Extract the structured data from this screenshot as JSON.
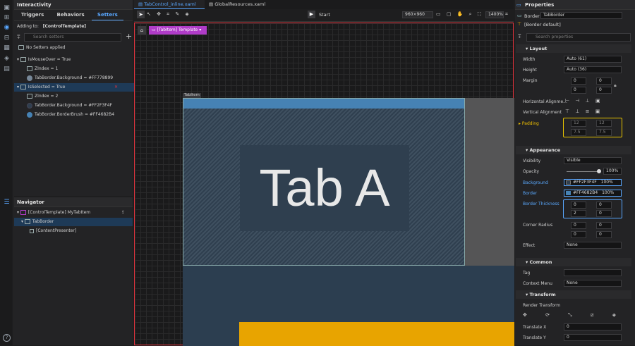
{
  "left_toolbar": {
    "icons": [
      "project-icon",
      "assets-icon",
      "interactivity-icon",
      "data-icon",
      "resources-icon",
      "triggers-icon",
      "states-icon",
      "navigator-icon"
    ],
    "help": "?"
  },
  "interactivity": {
    "title": "Interactivity",
    "tabs": [
      "Triggers",
      "Behaviors",
      "Setters"
    ],
    "adding_for_label": "Adding to:",
    "adding_for_value": "[ControlTemplate]",
    "search_placeholder": "Search setters",
    "rows": [
      "No Setters applied",
      "IsMouseOver = True",
      "ZIndex = 1",
      "TabBorder.Background = #FF778899",
      "IsSelected = True",
      "ZIndex = 2",
      "TabBorder.Background = #FF2F3F4F",
      "TabBorder.BorderBrush = #FF4682B4"
    ]
  },
  "navigator": {
    "title": "Navigator",
    "rows": [
      "[ControlTemplate] MyTabItem",
      "TabBorder",
      "[ContentPresenter]"
    ]
  },
  "editor": {
    "tabs": [
      "TabControl_inline.xaml",
      "GlobalResources.xaml"
    ],
    "start_label": "Start",
    "resolution": "960×960",
    "zoom": "1400%",
    "breadcrumb": "[TabItem] Template",
    "adorner_label": "TabItem",
    "content_text": "Tab A"
  },
  "properties": {
    "title": "Properties",
    "element_type": "Border",
    "element_name": "TabBorder",
    "style_label": "[Border default]",
    "search_placeholder": "Search properties",
    "layout": {
      "title": "Layout",
      "width_label": "Width",
      "width": "Auto (61)",
      "height_label": "Height",
      "height": "Auto (36)",
      "margin_label": "Margin",
      "margin": [
        "0",
        "0",
        "0",
        "0"
      ],
      "halign_label": "Horizontal Alignme...",
      "valign_label": "Vertical Alignment",
      "padding_label": "Padding",
      "padding": [
        "12",
        "12",
        "7.5",
        "7.5"
      ]
    },
    "appearance": {
      "title": "Appearance",
      "visibility_label": "Visibility",
      "visibility": "Visible",
      "opacity_label": "Opacity",
      "opacity": "100%",
      "background_label": "Background",
      "background": "#FF2F3F4F",
      "background_pct": "100%",
      "border_label": "Border",
      "border": "#FF4682B4",
      "border_pct": "100%",
      "thickness_label": "Border Thickness",
      "thickness": [
        "0",
        "0",
        "2",
        "0"
      ],
      "radius_label": "Corner Radius",
      "radius": [
        "0",
        "0",
        "0",
        "0"
      ],
      "effect_label": "Effect",
      "effect": "None"
    },
    "common": {
      "title": "Common",
      "tag_label": "Tag",
      "tag": "",
      "context_label": "Context Menu",
      "context": "None"
    },
    "transform": {
      "title": "Transform",
      "render_label": "Render Transform",
      "tx_label": "Translate X",
      "tx": "0",
      "ty_label": "Translate Y",
      "ty": "0"
    }
  },
  "colors": {
    "accent": "#59a7ff",
    "selection_border": "#e0323c",
    "tab_bg": "#2f3f4f",
    "tab_border": "#4682b4",
    "gold": "#e8a400",
    "purple": "#b03cc8"
  }
}
